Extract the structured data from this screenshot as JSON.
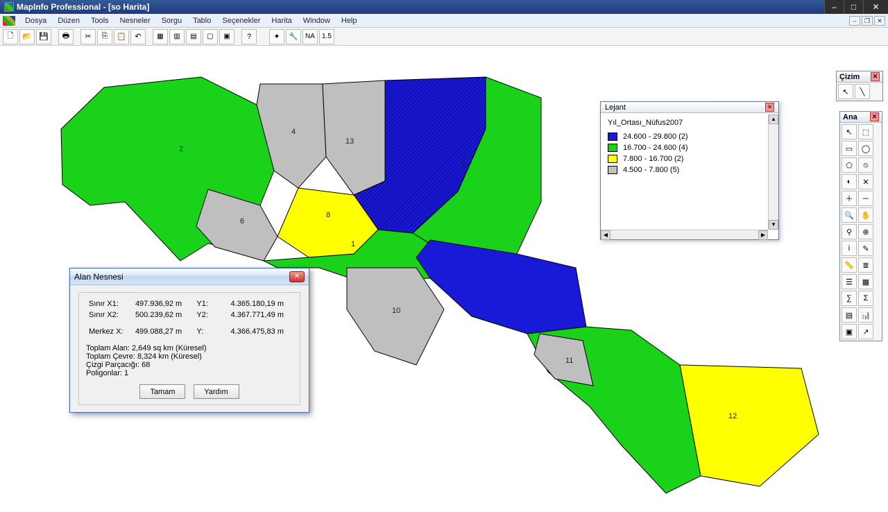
{
  "title": "MapInfo Professional - [so Harita]",
  "menus": [
    "Dosya",
    "Düzen",
    "Tools",
    "Nesneler",
    "Sorgu",
    "Tablo",
    "Seçenekler",
    "Harita",
    "Window",
    "Help"
  ],
  "toolbar_main": [
    "new",
    "open",
    "save",
    "print",
    "cut",
    "copy",
    "paste",
    "undo",
    "win1",
    "win2",
    "win3",
    "win4",
    "win5",
    "help-cursor"
  ],
  "toolbar_map": [
    "run",
    "wrench",
    "NA",
    "1.5"
  ],
  "region_labels": {
    "1": "1",
    "2": "2",
    "4": "4",
    "6": "6",
    "8": "8",
    "9": "9",
    "10": "10",
    "11": "11",
    "12": "12",
    "13": "13"
  },
  "cizim_panel": {
    "title": "Çizim",
    "tools": [
      "select",
      "line"
    ]
  },
  "ana_panel": {
    "title": "Ana",
    "tools": [
      "pointer",
      "dotted-select",
      "marquee",
      "radius-select",
      "polygon-select",
      "no-entry",
      "invert",
      "deselect",
      "zoom-in",
      "zoom-out",
      "view",
      "pan",
      "find",
      "center",
      "info",
      "draw",
      "ruler",
      "layer",
      "layers",
      "grid",
      "sum",
      "sigma",
      "table",
      "chart",
      "terminal",
      "arrow2"
    ]
  },
  "legend": {
    "title": "Lejant",
    "subtitle": "Yıl_Ortası_Nüfus2007",
    "rows": [
      {
        "color": "#1919d8",
        "text": "24.600 - 29.800  (2)"
      },
      {
        "color": "#19d219",
        "text": "16.700 - 24.600  (4)"
      },
      {
        "color": "#ffff00",
        "text": "7.800 - 16.700  (2)"
      },
      {
        "color": "#bfbfbf",
        "text": "4.500 -  7.800  (5)"
      }
    ]
  },
  "dialog": {
    "title": "Alan Nesnesi",
    "rows": [
      {
        "l1": "Sınır X1:",
        "v1": "497.936,92 m",
        "l2": "Y1:",
        "v2": "4.365.180,19 m"
      },
      {
        "l1": "Sınır X2:",
        "v1": "500.239,62 m",
        "l2": "Y2:",
        "v2": "4.367.771,49 m"
      },
      {
        "l1": "Merkez X:",
        "v1": "499.088,27 m",
        "l2": "Y:",
        "v2": "4.366.475,83 m"
      }
    ],
    "extras": [
      "Toplam Alan:  2,649 sq km (Küresel)",
      "Toplam Çevre:  8,324 km (Küresel)",
      "Çizgi Parçacığı:  68",
      "Poligonlar:  1"
    ],
    "ok": "Tamam",
    "help": "Yardım"
  },
  "chart_data": {
    "type": "map-choropleth",
    "title": "Yıl_Ortası_Nüfus2007",
    "bins": [
      {
        "range": [
          24600,
          29800
        ],
        "count": 2,
        "color": "#1919d8"
      },
      {
        "range": [
          16700,
          24600
        ],
        "count": 4,
        "color": "#19d219"
      },
      {
        "range": [
          7800,
          16700
        ],
        "count": 2,
        "color": "#ffff00"
      },
      {
        "range": [
          4500,
          7800
        ],
        "count": 5,
        "color": "#bfbfbf"
      }
    ],
    "regions": [
      {
        "id": 1,
        "bin": 1
      },
      {
        "id": 2,
        "bin": 1
      },
      {
        "id": 3,
        "bin": 1
      },
      {
        "id": 4,
        "bin": 3
      },
      {
        "id": 5,
        "bin": 0
      },
      {
        "id": 6,
        "bin": 3
      },
      {
        "id": 7,
        "bin": 0
      },
      {
        "id": 8,
        "bin": 2
      },
      {
        "id": 9,
        "bin": 1
      },
      {
        "id": 10,
        "bin": 3
      },
      {
        "id": 11,
        "bin": 3
      },
      {
        "id": 12,
        "bin": 2
      },
      {
        "id": 13,
        "bin": 3
      }
    ]
  }
}
